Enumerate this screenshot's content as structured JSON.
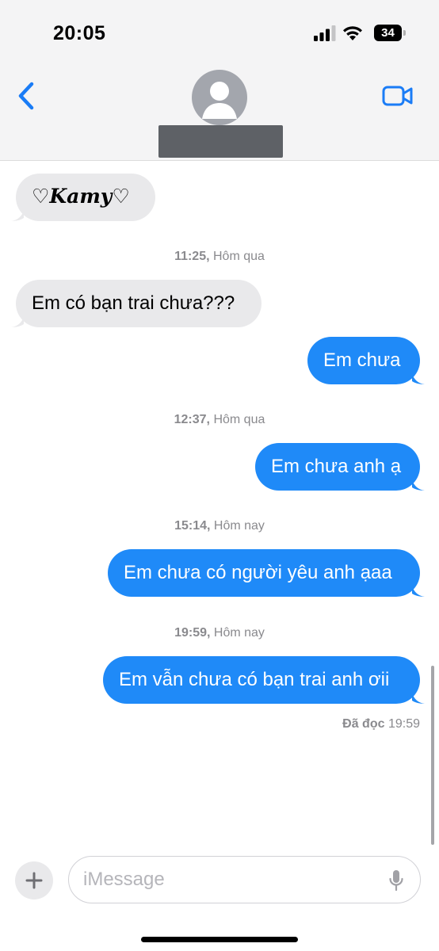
{
  "status_bar": {
    "time": "20:05",
    "battery": "34",
    "icons": [
      "cellular-signal-icon",
      "wifi-icon",
      "battery-icon"
    ]
  },
  "header": {
    "back_icon": "chevron-left-icon",
    "video_icon": "video-camera-icon",
    "avatar_icon": "person-silhouette-icon",
    "contact_name_redacted": true
  },
  "messages": [
    {
      "type": "bubble",
      "side": "incoming",
      "text": "♡𝑲𝒂𝒎𝒚♡"
    },
    {
      "type": "timestamp",
      "time": "11:25,",
      "day": "Hôm qua"
    },
    {
      "type": "bubble",
      "side": "incoming",
      "text": "Em có bạn trai chưa???"
    },
    {
      "type": "bubble",
      "side": "outgoing",
      "text": "Em chưa"
    },
    {
      "type": "timestamp",
      "time": "12:37,",
      "day": "Hôm qua"
    },
    {
      "type": "bubble",
      "side": "outgoing",
      "text": "Em chưa anh ạ"
    },
    {
      "type": "timestamp",
      "time": "15:14,",
      "day": "Hôm nay"
    },
    {
      "type": "bubble",
      "side": "outgoing",
      "text": "Em chưa có người yêu anh ạaa"
    },
    {
      "type": "timestamp",
      "time": "19:59,",
      "day": "Hôm nay"
    },
    {
      "type": "bubble",
      "side": "outgoing",
      "text": "Em vẫn chưa có bạn trai anh ơii"
    }
  ],
  "read_receipt": {
    "label": "Đã đọc",
    "time": "19:59"
  },
  "composer": {
    "placeholder": "iMessage",
    "value": "",
    "plus_icon": "plus-icon",
    "mic_icon": "microphone-icon"
  },
  "colors": {
    "outgoing_bubble": "#1f8af8",
    "incoming_bubble": "#e9e9eb",
    "accent": "#1a7cf6",
    "muted_text": "#8a8a8e"
  }
}
